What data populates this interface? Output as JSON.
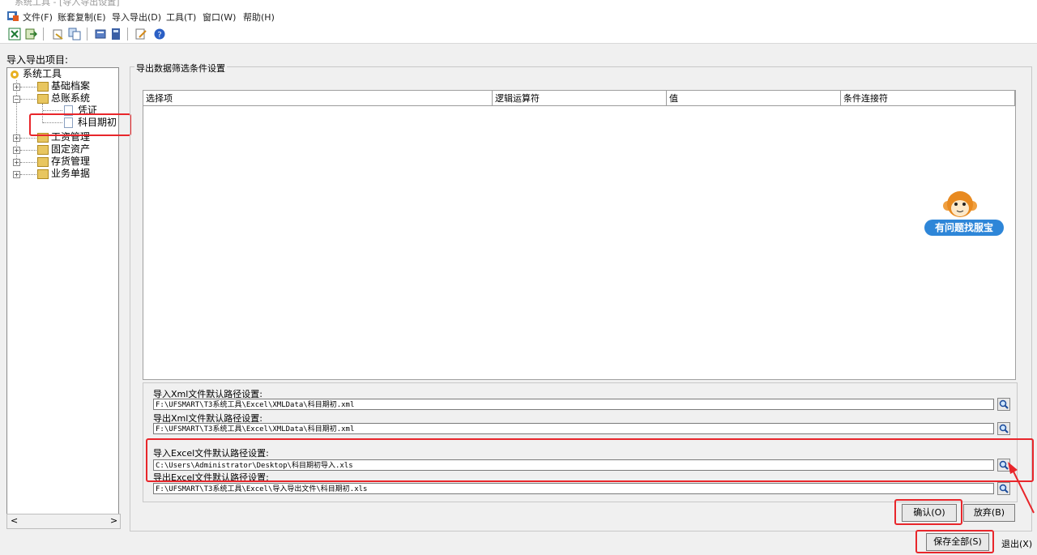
{
  "app": {
    "title": "系统工具 - [导入导出设置]"
  },
  "menu": [
    "文件(F)",
    "账套复制(E)",
    "导入导出(D)",
    "工具(T)",
    "窗口(W)",
    "帮助(H)"
  ],
  "left_panel": {
    "label": "导入导出项目:",
    "tree": {
      "root": "系统工具",
      "basic": "基础档案",
      "gl": "总账系统",
      "voucher": "凭证",
      "opening": "科目期初",
      "payroll": "工资管理",
      "assets": "固定资产",
      "inventory": "存货管理",
      "business": "业务单据"
    },
    "scroll_left": "<",
    "scroll_right": ">"
  },
  "filter": {
    "group_title": "导出数据筛选条件设置",
    "columns": [
      "选择项",
      "逻辑运算符",
      "值",
      "条件连接符"
    ]
  },
  "paths": {
    "xml_import_label": "导入Xml文件默认路径设置:",
    "xml_import_value": "F:\\UFSMART\\T3系统工具\\Excel\\XMLData\\科目期初.xml",
    "xml_export_label": "导出Xml文件默认路径设置:",
    "xml_export_value": "F:\\UFSMART\\T3系统工具\\Excel\\XMLData\\科目期初.xml",
    "excel_import_label": "导入Excel文件默认路径设置:",
    "excel_import_value": "C:\\Users\\Administrator\\Desktop\\科目期初导入.xls",
    "excel_export_label": "导出Excel文件默认路径设置:",
    "excel_export_value": "F:\\UFSMART\\T3系统工具\\Excel\\导入导出文件\\科目期初.xls"
  },
  "buttons": {
    "confirm": "确认(O)",
    "discard": "放弃(B)",
    "save_all": "保存全部(S)",
    "exit": "退出(X)"
  },
  "helper": {
    "label": "有问题找服宝"
  },
  "colors": {
    "highlight": "#e8262b",
    "badge": "#2e86d8"
  }
}
